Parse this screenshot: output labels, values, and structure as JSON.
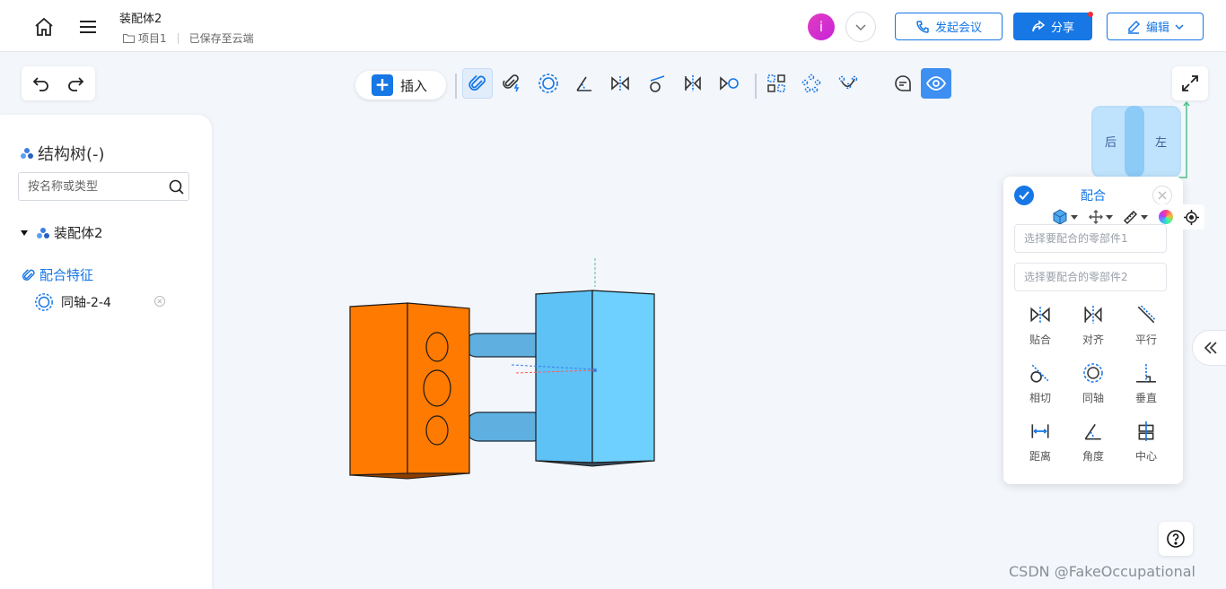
{
  "header": {
    "document_title": "装配体2",
    "project_label": "项目1",
    "save_status": "已保存至云端",
    "avatar_letter": "i",
    "meeting_button": "发起会议",
    "share_button": "分享",
    "edit_button": "编辑"
  },
  "toolbar": {
    "insert_label": "插入"
  },
  "tree": {
    "title": "结构树(-)",
    "search_placeholder": "按名称或类型",
    "assembly_name": "装配体2",
    "mate_section": "配合特征",
    "mate_item": "同轴-2-4"
  },
  "viewcube": {
    "face_back": "后",
    "face_left": "左"
  },
  "mate_panel": {
    "title": "配合",
    "part1_placeholder": "选择要配合的零部件1",
    "part2_placeholder": "选择要配合的零部件2",
    "types": [
      {
        "label": "贴合",
        "icon": "coincident-icon"
      },
      {
        "label": "对齐",
        "icon": "align-icon"
      },
      {
        "label": "平行",
        "icon": "parallel-icon"
      },
      {
        "label": "相切",
        "icon": "tangent-icon"
      },
      {
        "label": "同轴",
        "icon": "concentric-icon"
      },
      {
        "label": "垂直",
        "icon": "perpendicular-icon"
      },
      {
        "label": "距离",
        "icon": "distance-icon"
      },
      {
        "label": "角度",
        "icon": "angle-icon"
      },
      {
        "label": "中心",
        "icon": "center-icon"
      }
    ]
  },
  "colors": {
    "accent": "#1677E5",
    "orange_part": "#FF7A00",
    "blue_part": "#5EC2F7"
  },
  "watermark": "CSDN @FakeOccupational"
}
